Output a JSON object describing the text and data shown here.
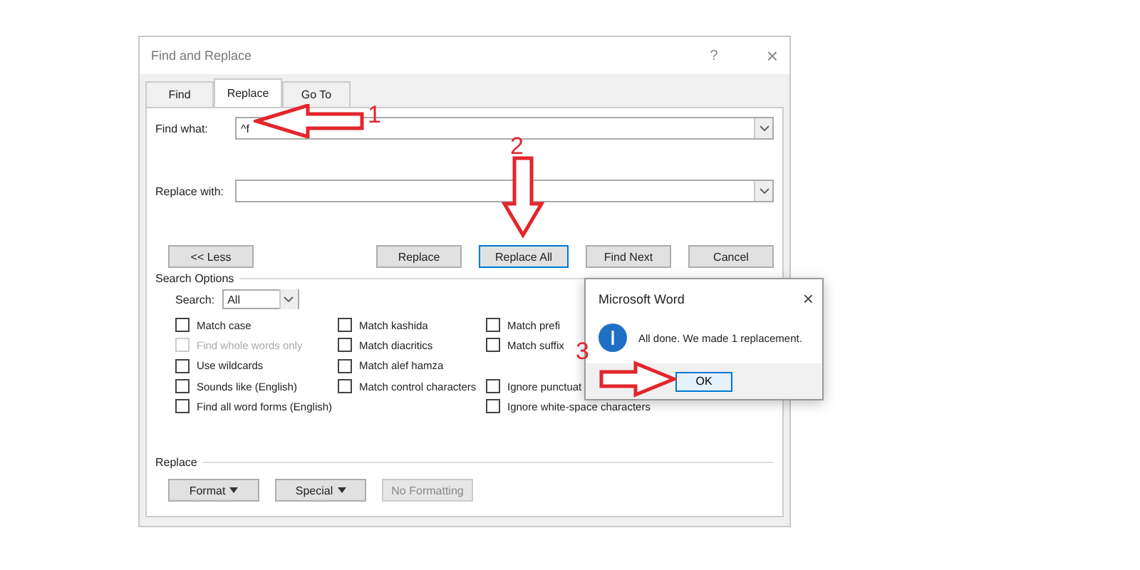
{
  "window": {
    "title": "Find and Replace",
    "help": "?",
    "close": "×"
  },
  "tabs": [
    {
      "label": "Find",
      "selected": false
    },
    {
      "label": "Replace",
      "selected": true
    },
    {
      "label": "Go To",
      "selected": false
    }
  ],
  "find_what": {
    "label": "Find what:",
    "value": "^f"
  },
  "replace_with": {
    "label": "Replace with:"
  },
  "less_button": "<< Less",
  "action_buttons": [
    {
      "label": "Replace",
      "default": false
    },
    {
      "label": "Replace All",
      "default": true
    },
    {
      "label": "Find Next",
      "default": false
    },
    {
      "label": "Cancel",
      "default": false
    }
  ],
  "search_options": {
    "heading": "Search Options",
    "search_label": "Search:",
    "search_value": "All",
    "columns": [
      [
        [
          {
            "label": "Match case",
            "checked": false,
            "disabled": false
          },
          {
            "label": "Find whole words only",
            "checked": false,
            "disabled": true
          },
          {
            "label": "Use wildcards",
            "checked": false,
            "disabled": false
          },
          {
            "label": "Sounds like (English)",
            "checked": false,
            "disabled": false
          },
          {
            "label": "Find all word forms (English)",
            "checked": false,
            "disabled": false
          }
        ]
      ],
      [
        [
          {
            "label": "Match kashida",
            "checked": false,
            "disabled": false
          },
          {
            "label": "Match diacritics",
            "checked": false,
            "disabled": false
          },
          {
            "label": "Match alef hamza",
            "checked": false,
            "disabled": false
          },
          {
            "label": "Match control characters",
            "checked": false,
            "disabled": false
          }
        ]
      ],
      [
        [
          {
            "label": "Match prefi",
            "checked": false,
            "disabled": false
          },
          {
            "label": "Match suffix",
            "checked": false,
            "disabled": false
          }
        ],
        [
          {
            "label": "Ignore punctuat",
            "checked": false,
            "disabled": false
          },
          {
            "label": "Ignore white-space characters",
            "checked": false,
            "disabled": false
          }
        ]
      ]
    ]
  },
  "replace_section": {
    "heading": "Replace",
    "buttons": [
      {
        "label": "Format",
        "menu": true,
        "disabled": false
      },
      {
        "label": "Special",
        "menu": true,
        "disabled": false
      },
      {
        "label": "No Formatting",
        "menu": false,
        "disabled": true
      }
    ]
  },
  "message_box": {
    "title": "Microsoft Word",
    "close": "×",
    "message": "All done. We made 1 replacement.",
    "button": "OK"
  },
  "annotations": [
    {
      "label": "1"
    },
    {
      "label": "2"
    },
    {
      "label": "3"
    }
  ]
}
